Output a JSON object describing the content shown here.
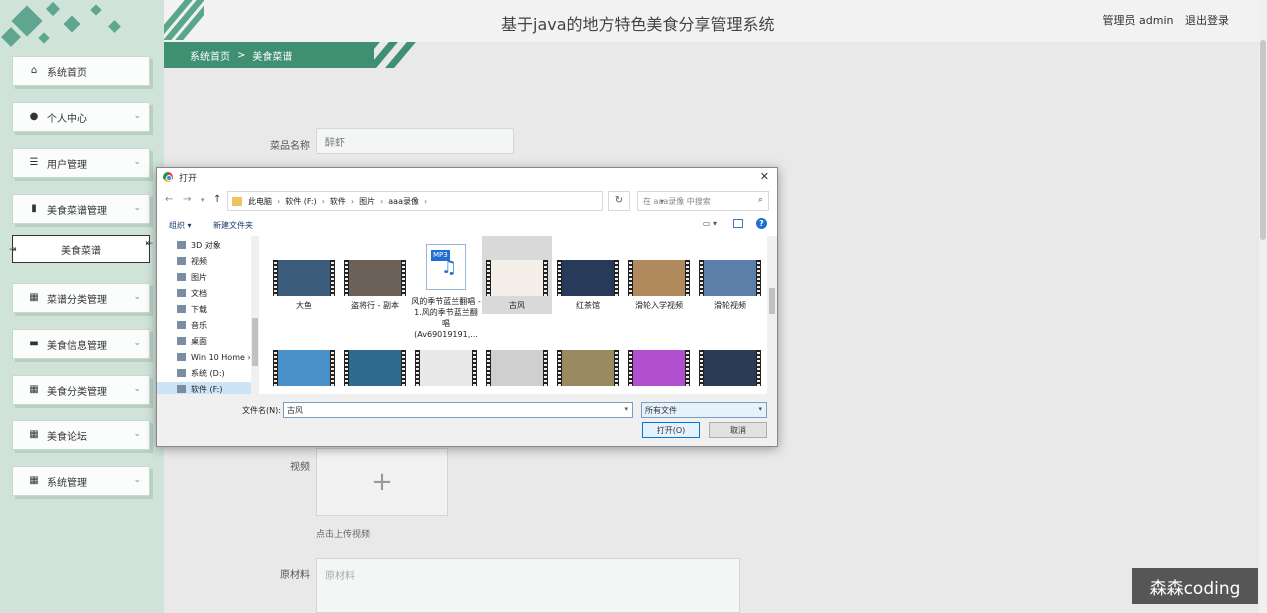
{
  "header": {
    "title": "基于java的地方特色美食分享管理系统",
    "user": "管理员 admin",
    "logout": "退出登录"
  },
  "breadcrumb": {
    "home": "系统首页",
    "sep": ">",
    "current": "美食菜谱"
  },
  "sidebar": {
    "items": [
      {
        "label": "系统首页",
        "icon": "home-icon",
        "glyph": "⌂",
        "chevron": false
      },
      {
        "label": "个人中心",
        "icon": "user-icon",
        "glyph": "●",
        "chevron": true
      },
      {
        "label": "用户管理",
        "icon": "list-icon",
        "glyph": "☰",
        "chevron": true
      },
      {
        "label": "美食菜谱管理",
        "icon": "bar-chart-icon",
        "glyph": "▮",
        "chevron": true
      },
      {
        "label": "菜谱分类管理",
        "icon": "grid-icon",
        "glyph": "▦",
        "chevron": true
      },
      {
        "label": "美食信息管理",
        "icon": "monitor-icon",
        "glyph": "▬",
        "chevron": true
      },
      {
        "label": "美食分类管理",
        "icon": "grid-icon",
        "glyph": "▦",
        "chevron": true
      },
      {
        "label": "美食论坛",
        "icon": "grid-icon",
        "glyph": "▦",
        "chevron": true
      },
      {
        "label": "系统管理",
        "icon": "grid-icon",
        "glyph": "▦",
        "chevron": true
      }
    ],
    "submenu_active": "美食菜谱"
  },
  "form": {
    "dish_name_label": "菜品名称",
    "dish_name_value": "醉虾",
    "video_label": "视频",
    "upload_plus": "+",
    "upload_hint": "点击上传视频",
    "ingredients_label": "原材料",
    "ingredients_placeholder": "原材料"
  },
  "dialog": {
    "title": "打开",
    "close": "✕",
    "path": [
      "此电脑",
      "软件 (F:)",
      "软件",
      "图片",
      "aaa录像"
    ],
    "search_placeholder": "在 aaa录像 中搜索",
    "organize": "组织 ▾",
    "new_folder": "新建文件夹",
    "tree": [
      "3D 对象",
      "视频",
      "图片",
      "文档",
      "下载",
      "音乐",
      "桌面",
      "Win 10 Home ›",
      "系统 (D:)",
      "软件 (F:)"
    ],
    "files_row1": [
      "大鱼",
      "盗将行 - 副本",
      "风的季节蓝兰翻唱 - 1.风的季节蓝兰翻唱 (Av69019191,...",
      "古风",
      "红茶馆",
      "滑轮入学视频",
      "滑轮视频"
    ],
    "files_row2": [
      "",
      "",
      "",
      "",
      "",
      "",
      ""
    ],
    "mp3_label": "MP3",
    "filename_label": "文件名(N):",
    "filename_value": "古风",
    "filetype_value": "所有文件",
    "open_button": "打开(O)",
    "cancel_button": "取消"
  },
  "watermark": "森森coding",
  "colors": {
    "accent": "#3f8f73",
    "sidebar_bg": "#cfe3d9"
  }
}
